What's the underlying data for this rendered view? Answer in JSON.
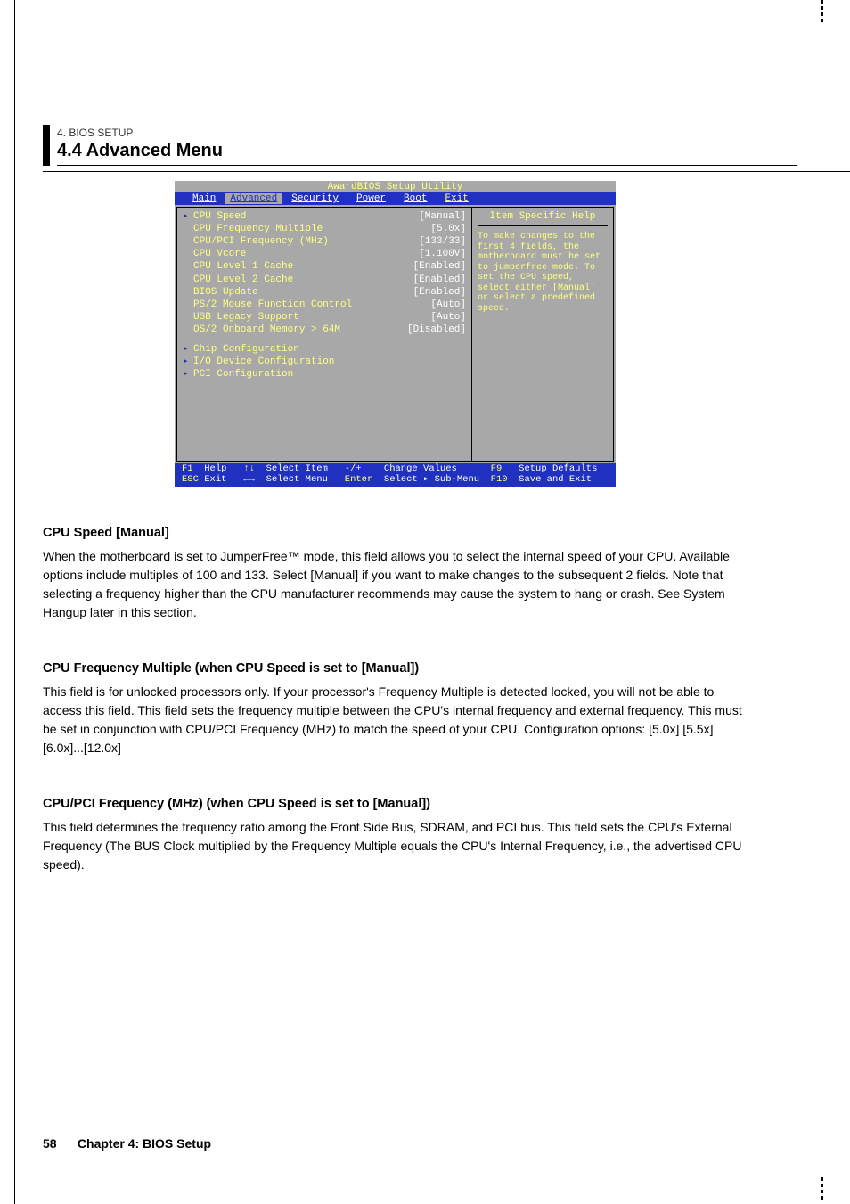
{
  "header": {
    "subtitle": "4. BIOS SETUP",
    "title": "4.4 Advanced Menu"
  },
  "bios": {
    "title": "AwardBIOS Setup Utility",
    "tabs": [
      "Main",
      "Advanced",
      "Security",
      "Power",
      "Boot",
      "Exit"
    ],
    "active_tab": "Advanced",
    "rows": [
      {
        "label": "CPU Speed",
        "value": "[Manual]"
      },
      {
        "label": "CPU Frequency Multiple",
        "value": "[5.0x]"
      },
      {
        "label": "CPU/PCI Frequency (MHz)",
        "value": "[133/33]"
      },
      {
        "label": "CPU Vcore",
        "value": "[1.100V]"
      },
      {
        "label": "CPU Level 1 Cache",
        "value": "[Enabled]"
      },
      {
        "label": "CPU Level 2 Cache",
        "value": "[Enabled]"
      },
      {
        "label": "BIOS Update",
        "value": "[Enabled]"
      },
      {
        "label": "PS/2 Mouse Function Control",
        "value": "[Auto]"
      },
      {
        "label": "USB Legacy Support",
        "value": "[Auto]"
      },
      {
        "label": "OS/2 Onboard Memory > 64M",
        "value": "[Disabled]"
      }
    ],
    "submenus": [
      "Chip Configuration",
      "I/O Device Configuration",
      "PCI Configuration"
    ],
    "help": {
      "title": "Item Specific Help",
      "body": "To make changes to the first 4 fields, the motherboard must be set to jumperfree mode. To set the CPU speed, select either [Manual] or select a predefined speed."
    },
    "footer": {
      "r1": {
        "k1": "F1",
        "l1": "Help",
        "k2": "↑↓",
        "l2": "Select Item",
        "k3": "-/+",
        "l3": "Change Values",
        "k4": "F9",
        "l4": "Setup Defaults"
      },
      "r2": {
        "k1": "ESC",
        "l1": "Exit",
        "k2": "←→",
        "l2": "Select Menu",
        "k3": "Enter",
        "l3": "Select ▸ Sub-Menu",
        "k4": "F10",
        "l4": "Save and Exit"
      }
    }
  },
  "options": [
    {
      "title": "CPU Speed [Manual]",
      "body": "When the motherboard is set to JumperFree™ mode, this field allows you to select the internal speed of your CPU. Available options include multiples of 100 and 133. Select [Manual] if you want to make changes to the subsequent 2 fields. Note that selecting a frequency higher than the CPU manufacturer recommends may cause the system to hang or crash. See System Hangup later in this section."
    },
    {
      "title": "CPU Frequency Multiple (when CPU Speed is set to [Manual])",
      "body": "This field is for unlocked processors only. If your processor's Frequency Multiple is detected locked, you will not be able to access this field. This field sets the frequency multiple between the CPU's internal frequency and external frequency. This must be set in conjunction with CPU/PCI Frequency (MHz) to match the speed of your CPU. Configuration options: [5.0x] [5.5x] [6.0x]...[12.0x]"
    },
    {
      "title": "CPU/PCI Frequency (MHz) (when CPU Speed is set to [Manual])",
      "body": "This field determines the frequency ratio among the Front Side Bus, SDRAM, and PCI bus. This field sets the CPU's External Frequency (The BUS Clock multiplied by the Frequency Multiple equals the CPU's Internal Frequency, i.e., the advertised CPU speed)."
    }
  ],
  "footer_text": {
    "page": "58",
    "chapter": "Chapter 4: BIOS Setup"
  }
}
